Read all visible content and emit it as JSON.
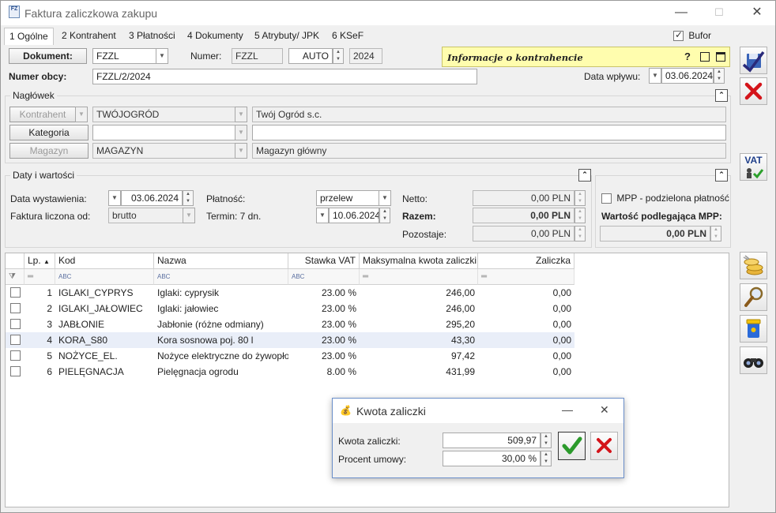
{
  "window": {
    "title": "Faktura zaliczkowa zakupu",
    "icon_text": "FZ"
  },
  "tabs": [
    {
      "label": "1 Ogólne"
    },
    {
      "label": "2 Kontrahent"
    },
    {
      "label": "3 Płatności"
    },
    {
      "label": "4 Dokumenty"
    },
    {
      "label": "5 Atrybuty/ JPK"
    },
    {
      "label": "6 KSeF"
    }
  ],
  "bufor": {
    "label": "Bufor",
    "checked": true
  },
  "document": {
    "button": "Dokument:",
    "type": "FZZL",
    "numer_label": "Numer:",
    "numer_prefix": "FZZL",
    "numer_auto": "AUTO",
    "numer_year": "2024",
    "numer_obcy_label": "Numer obcy:",
    "numer_obcy": "FZZL/2/2024",
    "data_wplywu_label": "Data wpływu:",
    "data_wplywu": "03.06.2024"
  },
  "info_kontrahent": {
    "label": "Informacje o kontrahencie",
    "help": "?"
  },
  "naglowek": {
    "title": "Nagłówek",
    "kontrahent_btn": "Kontrahent",
    "kontrahent_code": "TWÓJOGRÓD",
    "kontrahent_name": "Twój Ogród s.c.",
    "kategoria_btn": "Kategoria",
    "kategoria_code": "",
    "kategoria_desc": "",
    "magazyn_btn": "Magazyn",
    "magazyn_code": "MAGAZYN",
    "magazyn_name": "Magazyn główny"
  },
  "daty": {
    "title": "Daty i wartości",
    "data_wyst_label": "Data wystawienia:",
    "data_wyst": "03.06.2024",
    "liczona_label": "Faktura liczona od:",
    "liczona": "brutto",
    "platnosc_label": "Płatność:",
    "platnosc": "przelew",
    "termin_label": "Termin: 7 dn.",
    "termin": "10.06.2024",
    "netto_label": "Netto:",
    "netto": "0,00 PLN",
    "razem_label": "Razem:",
    "razem": "0,00 PLN",
    "pozostaje_label": "Pozostaje:",
    "pozostaje": "0,00 PLN"
  },
  "mpp": {
    "label": "MPP - podzielona płatność",
    "checked": false,
    "wartosc_label": "Wartość podlegająca MPP:",
    "wartosc": "0,00 PLN"
  },
  "table": {
    "headers": {
      "lp": "Lp.",
      "kod": "Kod",
      "nazwa": "Nazwa",
      "stawka": "Stawka VAT",
      "max": "Maksymalna kwota zaliczki",
      "zaliczka": "Zaliczka"
    },
    "filter_glyph": "ABC",
    "filter_eq": "═",
    "rows": [
      {
        "lp": "1",
        "kod": "IGLAKI_CYPRYS",
        "nazwa": "Iglaki: cyprysik",
        "stawka": "23.00 %",
        "max": "246,00",
        "zaliczka": "0,00"
      },
      {
        "lp": "2",
        "kod": "IGLAKI_JAŁOWIEC",
        "nazwa": "Iglaki: jałowiec",
        "stawka": "23.00 %",
        "max": "246,00",
        "zaliczka": "0,00"
      },
      {
        "lp": "3",
        "kod": "JABŁONIE",
        "nazwa": "Jabłonie (różne odmiany)",
        "stawka": "23.00 %",
        "max": "295,20",
        "zaliczka": "0,00"
      },
      {
        "lp": "4",
        "kod": "KORA_S80",
        "nazwa": "Kora sosnowa poj. 80 l",
        "stawka": "23.00 %",
        "max": "43,30",
        "zaliczka": "0,00"
      },
      {
        "lp": "5",
        "kod": "NOŻYCE_EL.",
        "nazwa": "Nożyce elektryczne do żywopłotu",
        "stawka": "23.00 %",
        "max": "97,42",
        "zaliczka": "0,00"
      },
      {
        "lp": "6",
        "kod": "PIELĘGNACJA",
        "nazwa": "Pielęgnacja ogrodu",
        "stawka": "8.00 %",
        "max": "431,99",
        "zaliczka": "0,00"
      }
    ]
  },
  "side": {
    "vat_label": "VAT"
  },
  "dialog": {
    "title": "Kwota zaliczki",
    "kwota_label": "Kwota zaliczki:",
    "kwota": "509,97",
    "procent_label": "Procent umowy:",
    "procent": "30,00 %"
  }
}
